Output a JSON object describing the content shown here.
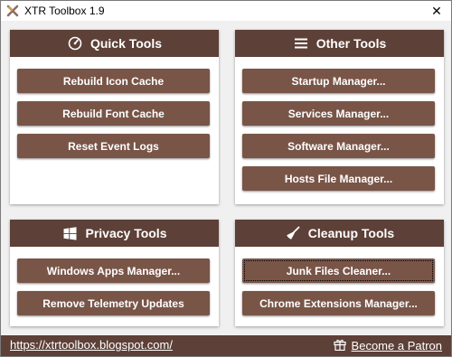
{
  "window": {
    "title": "XTR Toolbox 1.9",
    "close_glyph": "✕"
  },
  "colors": {
    "header": "#5d4037",
    "button": "#795548",
    "background": "#f0f0f0"
  },
  "panels": {
    "quick": {
      "title": "Quick Tools",
      "icon": "speedometer-icon",
      "buttons": [
        "Rebuild Icon Cache",
        "Rebuild Font Cache",
        "Reset Event Logs"
      ]
    },
    "other": {
      "title": "Other Tools",
      "icon": "menu-icon",
      "buttons": [
        "Startup Manager...",
        "Services Manager...",
        "Software Manager...",
        "Hosts File Manager..."
      ]
    },
    "privacy": {
      "title": "Privacy Tools",
      "icon": "windows-icon",
      "buttons": [
        "Windows Apps Manager...",
        "Remove Telemetry Updates"
      ]
    },
    "cleanup": {
      "title": "Cleanup Tools",
      "icon": "broom-icon",
      "buttons": [
        "Junk Files Cleaner...",
        "Chrome Extensions Manager..."
      ]
    }
  },
  "footer": {
    "link": "https://xtrtoolbox.blogspot.com/",
    "patron": "Become a Patron",
    "patron_icon": "gift-icon"
  }
}
